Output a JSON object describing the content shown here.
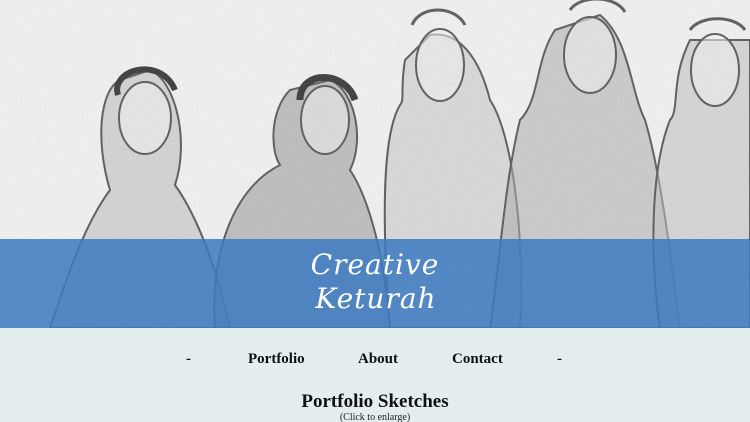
{
  "header": {
    "logo_line1": "Creative",
    "logo_line2": "Keturah",
    "hero_image": "pencil-sketch-of-five-girls"
  },
  "nav": {
    "separator_left": "-",
    "separator_right": "-",
    "items": [
      {
        "label": "Portfolio"
      },
      {
        "label": "About"
      },
      {
        "label": "Contact"
      }
    ]
  },
  "main": {
    "title": "Portfolio Sketches",
    "subtitle": "(Click to enlarge)"
  },
  "colors": {
    "banner": "#3e7ac0",
    "background": "#e4eeee"
  }
}
